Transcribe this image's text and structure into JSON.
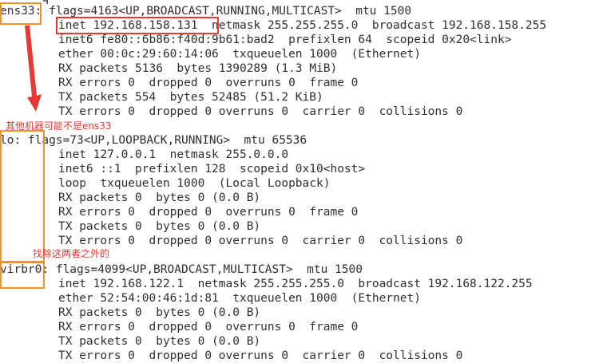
{
  "terminal": {
    "cut_top": "      q                                       ",
    "ens33": {
      "header": "ens33: flags=4163<UP,BROADCAST,RUNNING,MULTICAST>  mtu 1500",
      "lines": [
        "inet 192.168.158.131  netmask 255.255.255.0  broadcast 192.168.158.255",
        "inet6 fe80::6b86:f40d:9b61:bad2  prefixlen 64  scopeid 0x20<link>",
        "ether 00:0c:29:60:14:06  txqueuelen 1000  (Ethernet)",
        "RX packets 5136  bytes 1390289 (1.3 MiB)",
        "RX errors 0  dropped 0  overruns 0  frame 0",
        "TX packets 554  bytes 52485 (51.2 KiB)",
        "TX errors 0  dropped 0 overruns 0  carrier 0  collisions 0"
      ]
    },
    "lo": {
      "header": "lo: flags=73<UP,LOOPBACK,RUNNING>  mtu 65536",
      "lines": [
        "inet 127.0.0.1  netmask 255.0.0.0",
        "inet6 ::1  prefixlen 128  scopeid 0x10<host>",
        "loop  txqueuelen 1000  (Local Loopback)",
        "RX packets 0  bytes 0 (0.0 B)",
        "RX errors 0  dropped 0  overruns 0  frame 0",
        "TX packets 0  bytes 0 (0.0 B)",
        "TX errors 0  dropped 0 overruns 0  carrier 0  collisions 0"
      ]
    },
    "virbr0": {
      "header": "virbr0: flags=4099<UP,BROADCAST,MULTICAST>  mtu 1500",
      "lines": [
        "inet 192.168.122.1  netmask 255.255.255.0  broadcast 192.168.122.255",
        "ether 52:54:00:46:1d:81  txqueuelen 1000  (Ethernet)",
        "RX packets 0  bytes 0 (0.0 B)",
        "RX errors 0  dropped 0  overruns 0  frame 0",
        "TX packets 0  bytes 0 (0.0 B)",
        "TX errors 0  dropped 0 overruns 0  carrier 0  collisions 0"
      ]
    }
  },
  "annotations": {
    "note_ens33": "其他机器可能不是ens33",
    "note_exclude": "找除这两者之外的",
    "colors": {
      "orange": "#f0922b",
      "red": "#e53935"
    }
  }
}
